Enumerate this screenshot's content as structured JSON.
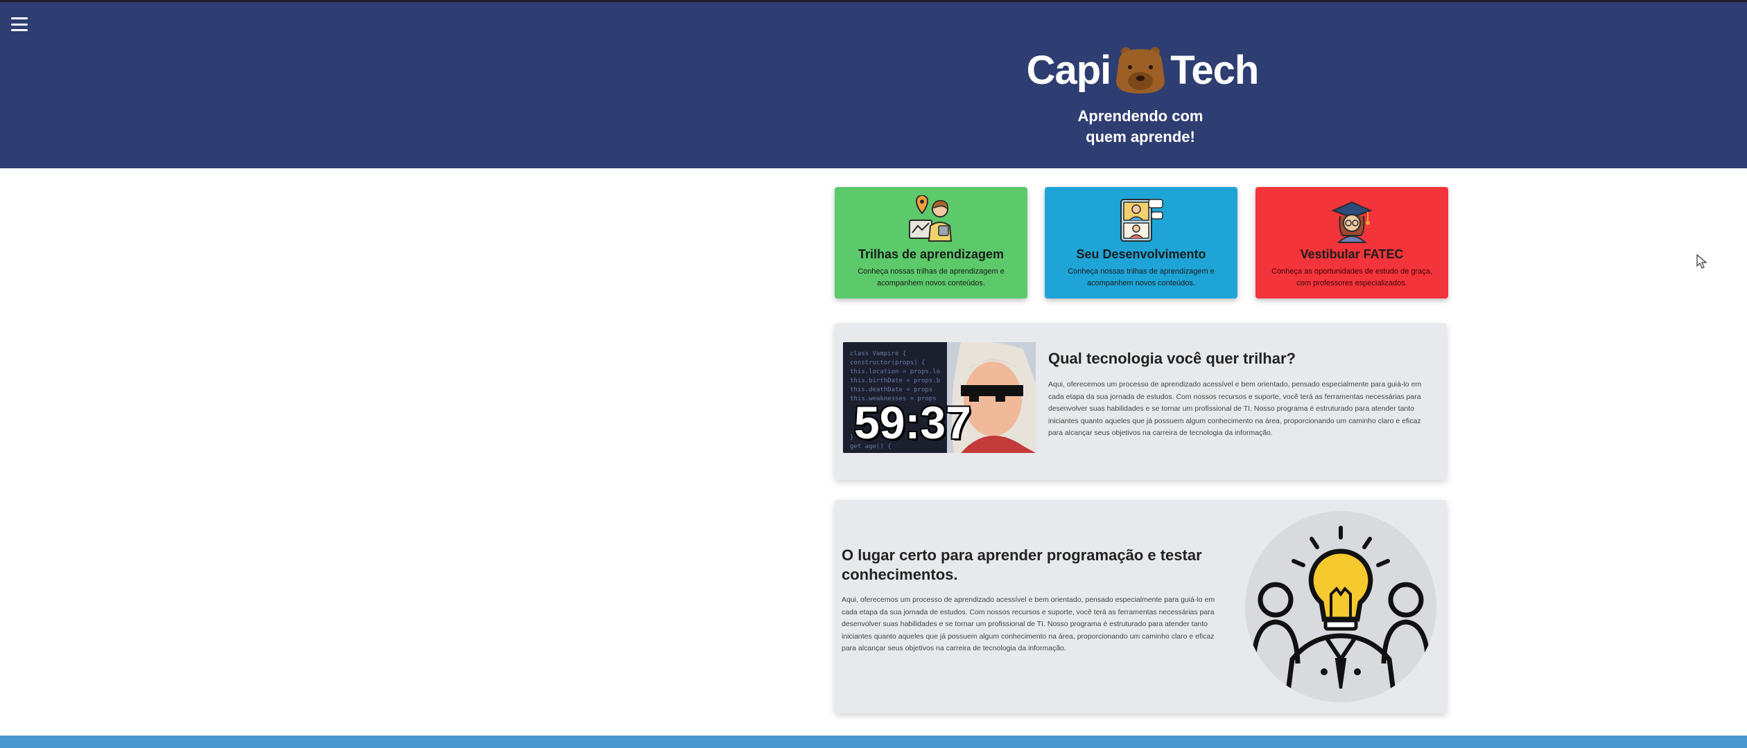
{
  "header": {
    "logo_left": "Capi",
    "logo_right": "Tech",
    "tagline_line1": "Aprendendo com",
    "tagline_line2": "quem aprende!"
  },
  "cards": [
    {
      "title": "Trilhas de aprendizagem",
      "description": "Conheça nossas trilhas de aprendizagem e acompanhem novos conteúdos."
    },
    {
      "title": "Seu Desenvolvimento",
      "description": "Conheça nossas trilhas de aprendizagem e acompanhem novos conteúdos."
    },
    {
      "title": "Vestibular FATEC",
      "description": "Conheça as oportunidades de estudo de graça, com professores especializados."
    }
  ],
  "section1": {
    "title": "Qual tecnologia você quer trilhar?",
    "text": "Aqui, oferecemos um processo de aprendizado acessível e bem orientado, pensado especialmente para guiá-lo em cada etapa da sua jornada de estudos. Com nossos recursos e suporte, você terá as ferramentas necessárias para desenvolver suas habilidades e se tornar um profissional de TI. Nosso programa é estruturado para atender tanto iniciantes quanto aqueles que já possuem algum conhecimento na área, proporcionando um caminho claro e eficaz para alcançar seus objetivos na carreira de tecnologia da informação.",
    "video_timer": "59:37",
    "code_lines": [
      "class Vampire {",
      "  constructor(props) {",
      "    this.location = props.lo",
      "    this.birthDate = props.b",
      "    this.deathDate = props",
      "    this.weaknesses = props",
      "  }",
      "  get age() {"
    ]
  },
  "section2": {
    "title": "O lugar certo para aprender programação e testar conhecimentos.",
    "text": "Aqui, oferecemos um processo de aprendizado acessível e bem orientado, pensado especialmente para guiá-lo em cada etapa da sua jornada de estudos. Com nossos recursos e suporte, você terá as ferramentas necessárias para desenvolver suas habilidades e se tornar um profissional de TI. Nosso programa é estruturado para atender tanto iniciantes quanto aqueles que já possuem algum conhecimento na área, proporcionando um caminho claro e eficaz para alcançar seus objetivos na carreira de tecnologia da informação."
  },
  "colors": {
    "header_bg": "#2e3e72",
    "card_green": "#5cc96a",
    "card_blue": "#1ea4d6",
    "card_red": "#f3343a",
    "panel_bg": "#e8e9ec",
    "footer_bar": "#4a97cf",
    "bulb_yellow": "#f6c92e"
  },
  "icons": {
    "menu": "hamburger-menu-icon",
    "logo_mascot": "capybara-icon",
    "card1": "map-learner-illustration",
    "card2": "video-call-illustration",
    "card3": "graduate-illustration",
    "section2": "lightbulb-team-illustration"
  }
}
